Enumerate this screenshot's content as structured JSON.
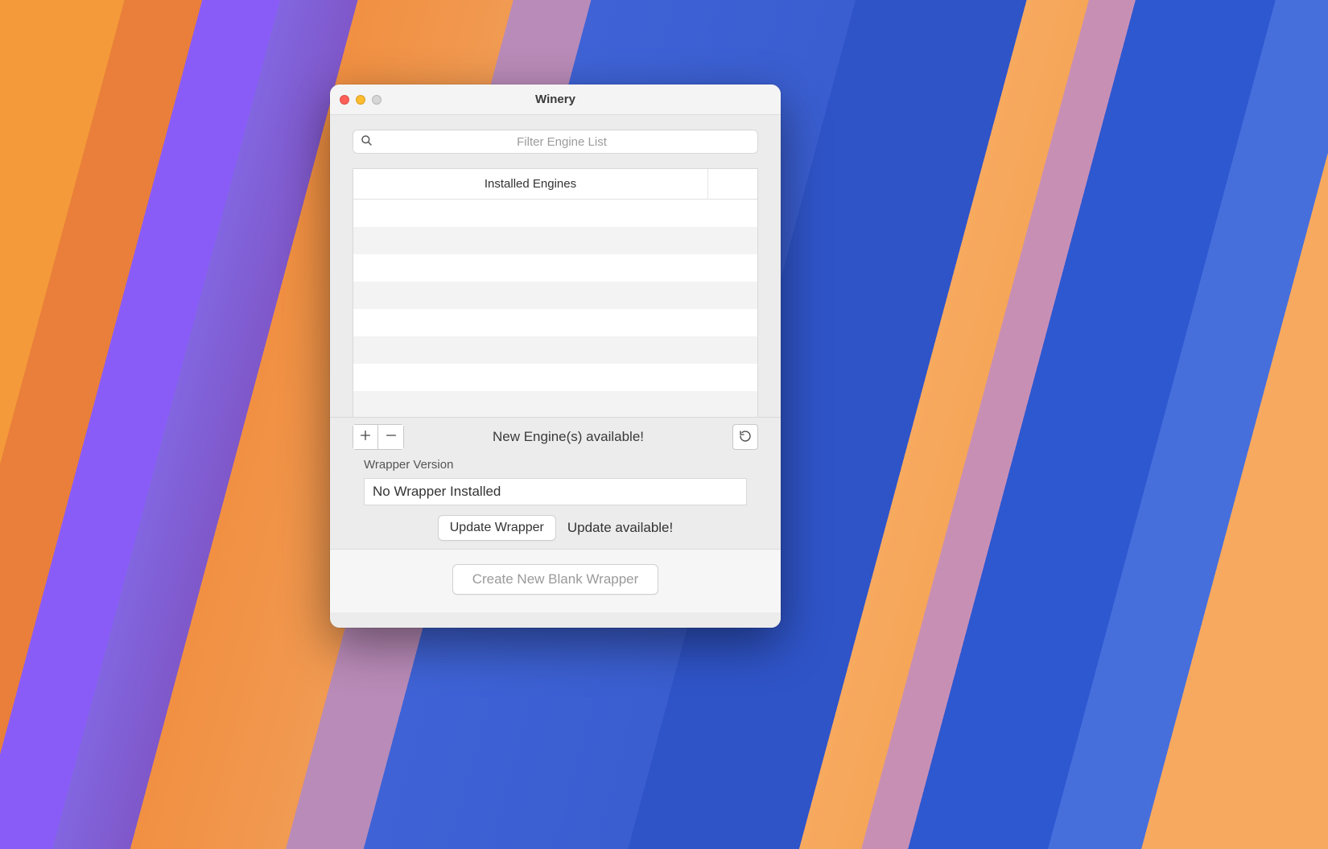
{
  "window": {
    "title": "Winery"
  },
  "search": {
    "placeholder": "Filter Engine List"
  },
  "table": {
    "header": "Installed Engines"
  },
  "toolbar": {
    "status": "New Engine(s) available!"
  },
  "wrapper": {
    "section_label": "Wrapper Version",
    "field_value": "No Wrapper Installed",
    "update_button": "Update Wrapper",
    "update_status": "Update available!"
  },
  "footer": {
    "create_button": "Create New Blank Wrapper"
  }
}
